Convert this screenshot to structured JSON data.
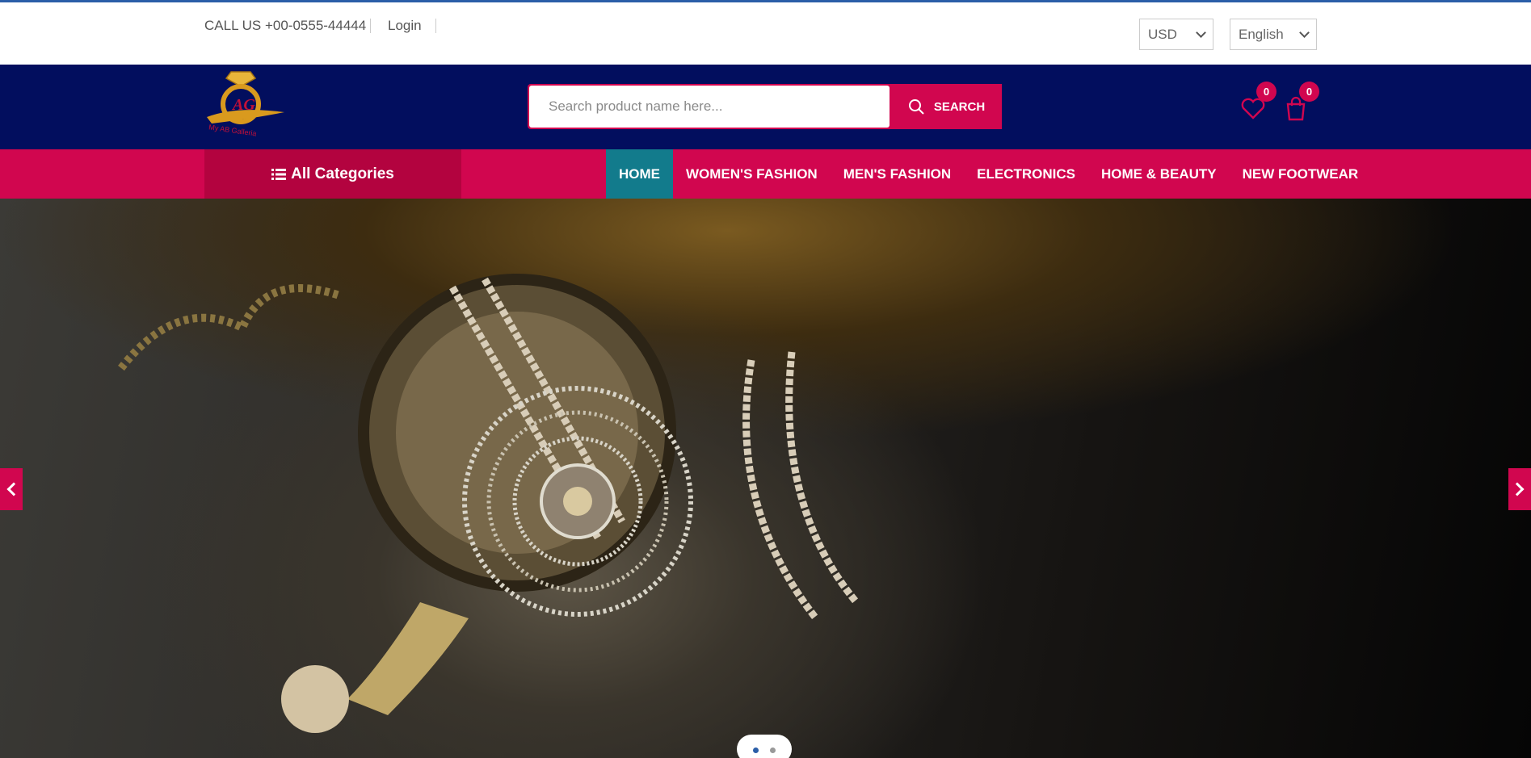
{
  "topbar": {
    "phone_text": "CALL US +00-0555-44444",
    "login_label": "Login",
    "currency": "USD",
    "language": "English"
  },
  "header": {
    "logo_text": "My AB Galleria",
    "search_placeholder": "Search product name here...",
    "search_button": "SEARCH",
    "wishlist_count": "0",
    "cart_count": "0"
  },
  "nav": {
    "all_categories": "All Categories",
    "items": [
      {
        "label": "HOME"
      },
      {
        "label": "WOMEN'S FASHION"
      },
      {
        "label": "MEN'S FASHION"
      },
      {
        "label": "ELECTRONICS"
      },
      {
        "label": "HOME & BEAUTY"
      },
      {
        "label": "NEW FOOTWEAR"
      }
    ]
  },
  "hero": {
    "slide_count": 2,
    "active_slide": 1
  },
  "colors": {
    "header_bg": "#020e5e",
    "accent": "#d1064f",
    "nav_active": "#127b8c"
  },
  "icons": [
    "list-icon",
    "search-icon",
    "heart-icon",
    "shopping-bag-icon",
    "chevron-left-icon",
    "chevron-right-icon",
    "chevron-down-icon"
  ]
}
